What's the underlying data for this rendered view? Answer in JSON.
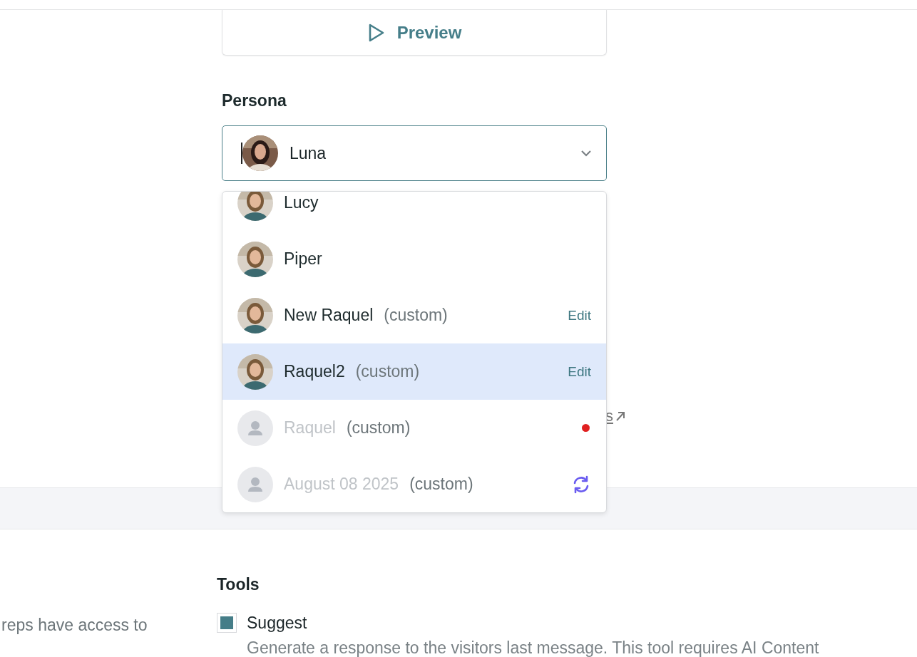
{
  "preview_button": {
    "label": "Preview"
  },
  "persona": {
    "label": "Persona",
    "value": "Luna",
    "options": [
      {
        "name": "Lucy",
        "has_photo": true,
        "disabled": false,
        "selected": false,
        "kind": "plain"
      },
      {
        "name": "Piper",
        "has_photo": true,
        "disabled": false,
        "selected": false,
        "kind": "plain"
      },
      {
        "name": "New Raquel",
        "suffix": "(custom)",
        "has_photo": true,
        "disabled": false,
        "selected": false,
        "kind": "editable",
        "action_label": "Edit"
      },
      {
        "name": "Raquel2",
        "suffix": "(custom)",
        "has_photo": true,
        "disabled": false,
        "selected": true,
        "kind": "editable",
        "action_label": "Edit"
      },
      {
        "name": "Raquel",
        "suffix": "(custom)",
        "has_photo": false,
        "disabled": true,
        "selected": false,
        "kind": "alert"
      },
      {
        "name": "August 08 2025",
        "suffix": "(custom)",
        "has_photo": false,
        "disabled": true,
        "selected": false,
        "kind": "syncing"
      }
    ],
    "hidden_link": "s"
  },
  "left_text": "reps have access to",
  "tools": {
    "title": "Tools",
    "items": [
      {
        "label": "Suggest",
        "checked": true,
        "description": "Generate a response to the visitors last message. This tool requires AI Content"
      }
    ]
  }
}
